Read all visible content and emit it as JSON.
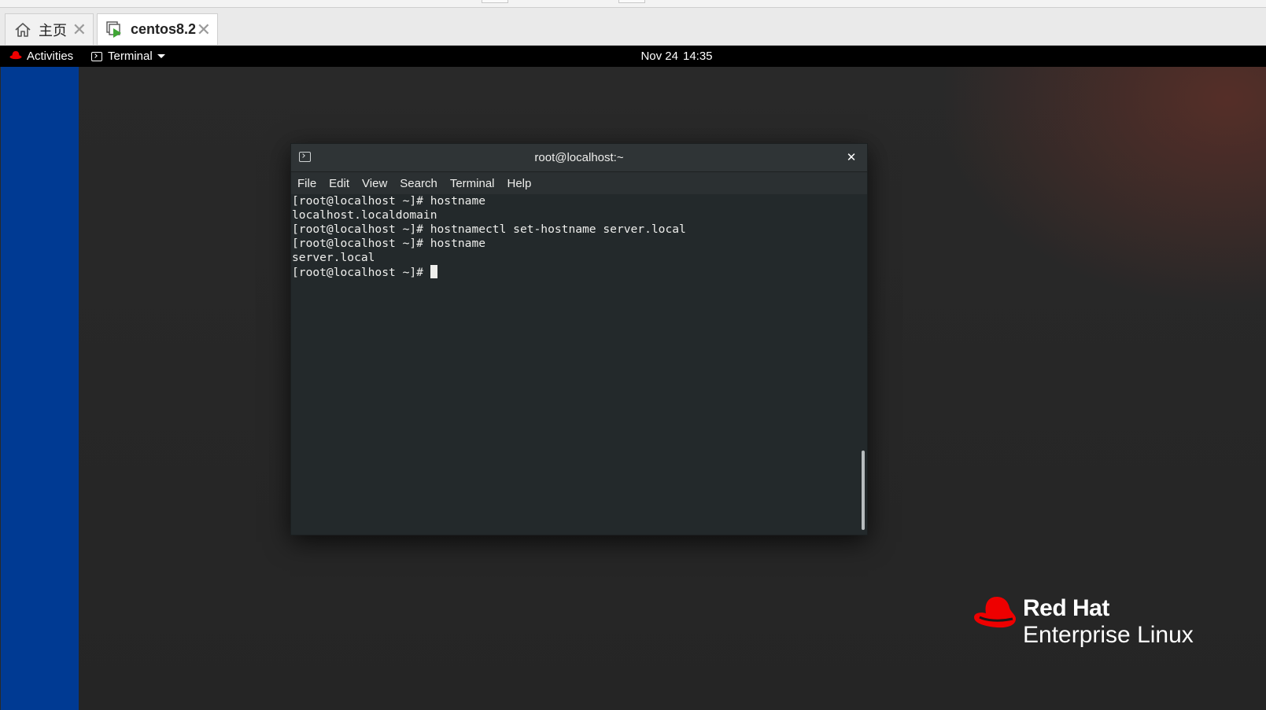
{
  "host_tabs": [
    {
      "label": "主页",
      "icon": "home-icon"
    },
    {
      "label": "centos8.2",
      "icon": "vm-running-icon"
    }
  ],
  "top_bar": {
    "activities": "Activities",
    "app_menu": "Terminal",
    "clock_date": "Nov 24",
    "clock_time": "14:35"
  },
  "terminal": {
    "title": "root@localhost:~",
    "menu": [
      "File",
      "Edit",
      "View",
      "Search",
      "Terminal",
      "Help"
    ],
    "lines": [
      "[root@localhost ~]# hostname",
      "localhost.localdomain",
      "[root@localhost ~]# hostnamectl set-hostname server.local",
      "[root@localhost ~]# hostname",
      "server.local",
      "[root@localhost ~]# "
    ]
  },
  "logo": {
    "line1": "Red Hat",
    "line2": "Enterprise Linux",
    "color": "#ee0000"
  },
  "colors": {
    "side_strip": "#003a93",
    "terminal_bg": "#23292b"
  }
}
